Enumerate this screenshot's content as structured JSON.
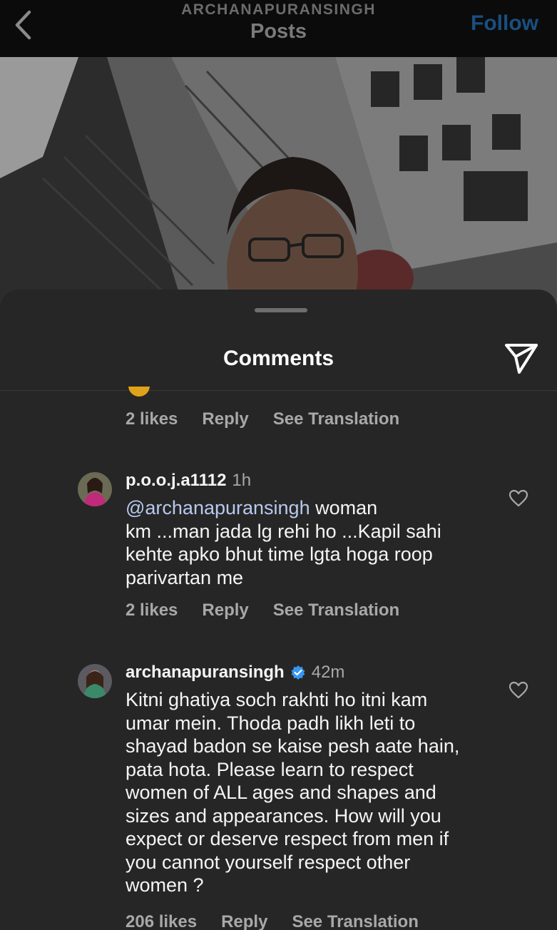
{
  "header": {
    "username": "ARCHANAPURANSINGH",
    "title": "Posts",
    "follow_label": "Follow"
  },
  "sheet": {
    "title": "Comments"
  },
  "previous_comment": {
    "likes": "2 likes",
    "reply": "Reply",
    "see_translation": "See Translation"
  },
  "comments": [
    {
      "username": "p.o.o.j.a1112",
      "time": "1h",
      "verified": false,
      "mention": "@archanapuransingh",
      "text_line1": " woman",
      "text_rest": "km ...man jada lg rehi ho ...Kapil sahi kehte apko bhut time lgta hoga roop parivartan me",
      "likes": "2 likes",
      "reply": "Reply",
      "see_translation": "See Translation"
    },
    {
      "username": "archanapuransingh",
      "time": "42m",
      "verified": true,
      "text": "Kitni ghatiya soch rakhti ho itni kam umar mein. Thoda padh likh leti to shayad badon se kaise pesh aate hain, pata hota. Please learn to respect women of ALL ages and shapes and sizes and appearances. How will you expect or deserve respect from men if you cannot yourself respect other women ?",
      "likes": "206 likes",
      "reply": "Reply",
      "see_translation": "See Translation"
    }
  ],
  "colors": {
    "background": "#262626",
    "header": "#0b0b0b",
    "follow": "#1a4f80",
    "verified": "#3897f0",
    "mention": "#b8c9ee",
    "secondary_text": "#a8a8a8"
  },
  "icons": {
    "back": "chevron-left-icon",
    "share": "paper-plane-icon",
    "like": "heart-outline-icon",
    "verified": "verified-badge-icon"
  }
}
